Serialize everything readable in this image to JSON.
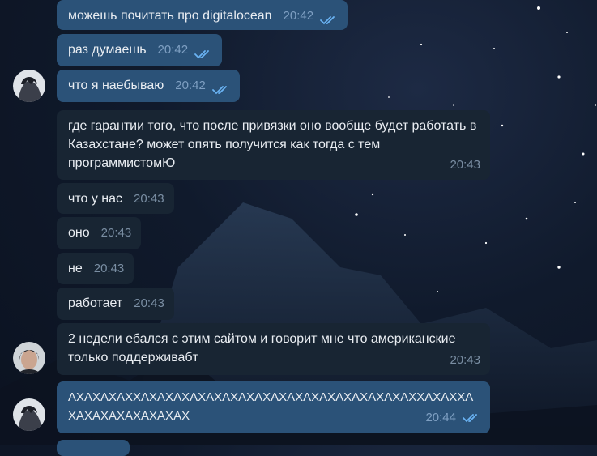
{
  "messages": [
    {
      "text": "можешь почитать про digitalocean",
      "time": "20:42",
      "outgoing": true,
      "read": true
    },
    {
      "text": "раз думаешь",
      "time": "20:42",
      "outgoing": true,
      "read": true
    },
    {
      "text": "что я наебываю",
      "time": "20:42",
      "outgoing": true,
      "read": true
    },
    {
      "text": "где гарантии того, что после привязки оно вообще будет работать в Казахстане? может опять получится как тогда с тем программистомЮ",
      "time": "20:43",
      "outgoing": false
    },
    {
      "text": "что у нас",
      "time": "20:43",
      "outgoing": false
    },
    {
      "text": "оно",
      "time": "20:43",
      "outgoing": false
    },
    {
      "text": "не",
      "time": "20:43",
      "outgoing": false
    },
    {
      "text": "работает",
      "time": "20:43",
      "outgoing": false
    },
    {
      "text": "2 недели ебался с этим сайтом и говорит мне что американские только поддерживабт",
      "time": "20:43",
      "outgoing": false
    },
    {
      "text": "АХАХАХАХХАХАХАХАХАХАХАХАХАХАХАХАХАХАХАХАХАХХАХАХХАХАХАХАХАХАХАХАХ",
      "time": "20:44",
      "outgoing": true,
      "read": true
    }
  ],
  "colors": {
    "outgoing": "#2b5278",
    "incoming": "#182533",
    "check": "#6ab3f3"
  },
  "icons": [
    "avatar-outgoing",
    "avatar-incoming",
    "double-check-icon"
  ]
}
